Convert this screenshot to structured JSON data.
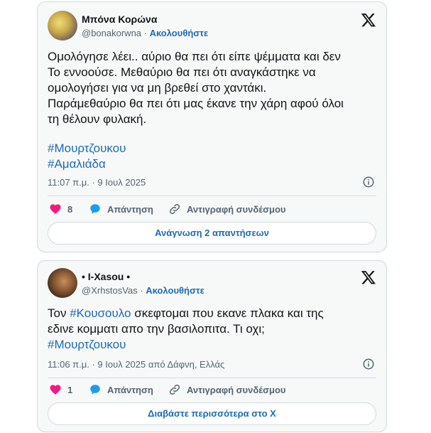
{
  "tweets": [
    {
      "name": "Μπόνα Κορώνα",
      "handle": "@bonakorwna",
      "separator": " · ",
      "follow": "Ακολουθήστε",
      "lines": [
        "Ομολόγησε λέει.. αύριο θα πει ότι είπε ψέμματα και δεν",
        "Το εννοούσε. Μεθαύριο θα πει ότι αναγκάστηκε να",
        "ομολογήσει για να μη βρεθεί στο χαντάκι.",
        "Παράμεθαύριο θα πει ότι μας έκανε την χάρη αφού όλοι",
        "τη θέλουν φυλακή."
      ],
      "hashtags": [
        "#Μουρτζουκου",
        "#Αμαλιάδα"
      ],
      "time": "11:07 π.μ. · 9 Ιουλ 2025",
      "likes": "8",
      "reply": "Απάντηση",
      "copy": "Αντιγραφή συνδέσμου",
      "button": "Ανάγνωση 2 απαντήσεων"
    },
    {
      "name": "• I-Xasou •",
      "handle": "@XrhstosVas",
      "separator": " · ",
      "follow": "Ακολουθήστε",
      "line1_pre": "Τον ",
      "line1_tag": "#Κουσουλο",
      "line1_post": " σκεφτομαι που εκανε πλακα και της",
      "line2": "εδινε κομματι απο την βασιλοπιτα. Τι οχι;",
      "hashtag": "#Μουρτζουκου",
      "time": "11:06 π.μ. · 9 Ιουλ 2025 από Δάφνη, Ελλάς",
      "likes": "1",
      "reply": "Απάντηση",
      "copy": "Αντιγραφή συνδέσμου",
      "button": "Διαβάστε περισσότερα στο X"
    }
  ],
  "colors": {
    "like": "#f91880",
    "reply": "#1d9bf0",
    "link": "#1d6ab3"
  },
  "icons": [
    "x-logo-icon",
    "info-icon",
    "heart-icon",
    "reply-bubble-icon",
    "link-icon"
  ]
}
